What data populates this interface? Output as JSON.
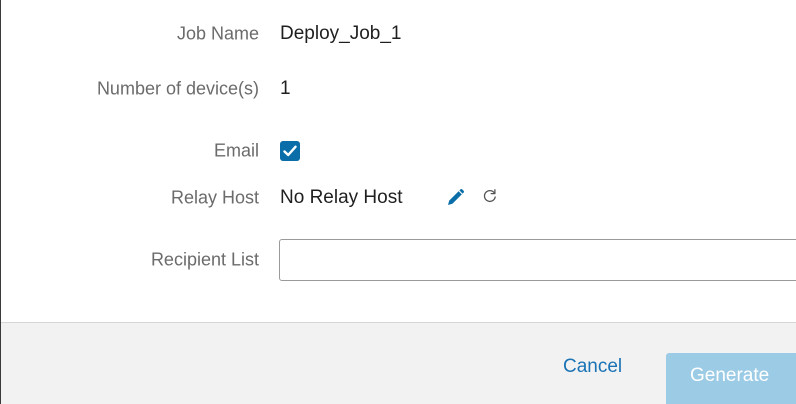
{
  "form": {
    "job_name": {
      "label": "Job Name",
      "value": "Deploy_Job_1"
    },
    "device_count": {
      "label": "Number of device(s)",
      "value": "1"
    },
    "email": {
      "label": "Email",
      "checked": true
    },
    "relay_host": {
      "label": "Relay Host",
      "value": "No Relay Host",
      "edit_icon": "pencil-icon",
      "refresh_icon": "refresh-icon"
    },
    "recipient_list": {
      "label": "Recipient List",
      "value": "",
      "placeholder": ""
    }
  },
  "footer": {
    "cancel_label": "Cancel",
    "generate_label": "Generate"
  },
  "colors": {
    "accent": "#0b6ea8",
    "link": "#1a73b5",
    "primary_disabled": "#9ccbe6"
  }
}
